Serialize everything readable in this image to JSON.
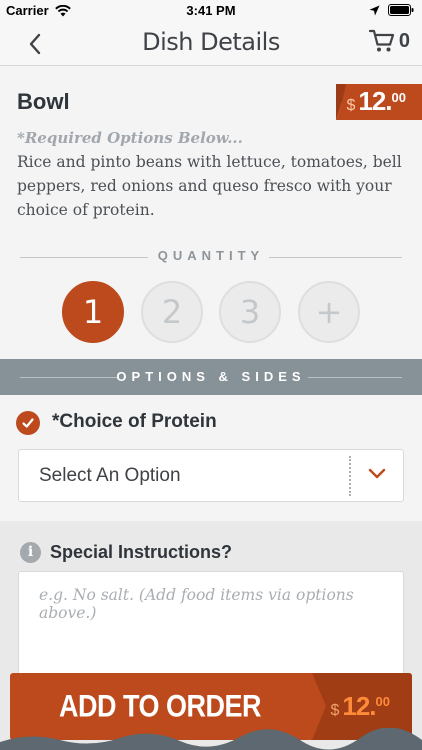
{
  "status_bar": {
    "carrier": "Carrier",
    "time": "3:41 PM"
  },
  "nav": {
    "title": "Dish Details",
    "cart_count": "0"
  },
  "dish": {
    "name": "Bowl",
    "price_symbol": "$",
    "price_main": "12.",
    "price_cents": "00",
    "required_note": "*Required Options Below...",
    "description": "Rice and pinto beans with lettuce, tomatoes, bell peppers, red onions and queso fresco with your choice of protein."
  },
  "quantity": {
    "label": "QUANTITY",
    "options": [
      "1",
      "2",
      "3",
      "+"
    ],
    "selected": "1"
  },
  "options_section": {
    "label": "OPTIONS & SIDES",
    "protein_label": "*Choice of Protein",
    "select_value": "Select An Option"
  },
  "special": {
    "label": "Special Instructions?",
    "placeholder": "e.g. No salt. (Add food items via options above.)"
  },
  "add_button": {
    "label": "ADD TO ORDER",
    "price_symbol": "$",
    "price_main": "12.",
    "price_cents": "00"
  },
  "colors": {
    "accent": "#bd4a1d",
    "options_bar": "#869198",
    "background": "#f4f4f4"
  }
}
